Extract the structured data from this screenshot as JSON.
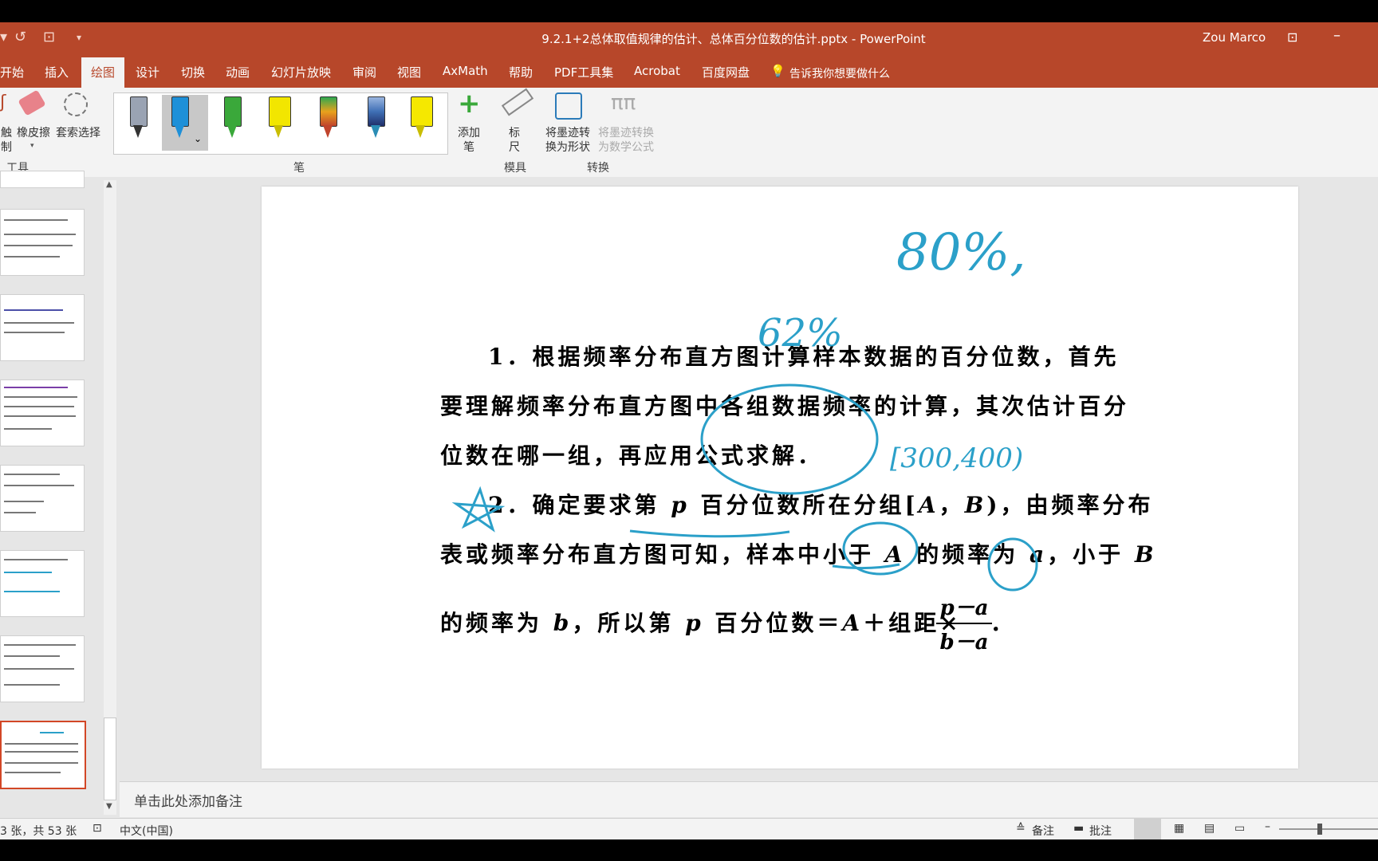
{
  "window": {
    "title": "9.2.1+2总体取值规律的估计、总体百分位数的估计.pptx  -  PowerPoint",
    "user": "Zou Marco"
  },
  "tabs": [
    "开始",
    "插入",
    "绘图",
    "设计",
    "切换",
    "动画",
    "幻灯片放映",
    "审阅",
    "视图",
    "AxMath",
    "帮助",
    "PDF工具集",
    "Acrobat",
    "百度网盘"
  ],
  "tell_me": "告诉我你想要做什么",
  "ribbon": {
    "draw_label": "触\n制",
    "eraser": "橡皮擦",
    "lasso": "套索选择",
    "tools_group": "工具",
    "pens_group": "笔",
    "add_pen": "添加\n笔",
    "ruler": "标\n尺",
    "stencils_group": "模具",
    "ink_to_shape": "将墨迹转\n换为形状",
    "ink_to_math": "将墨迹转换\n为数学公式",
    "convert_group": "转换",
    "pen_colors": [
      "#9aa3b3",
      "#1e90d8",
      "#3aa83a",
      "#f2e600",
      "#c0442c",
      "#3f6fb5",
      "#f5e800"
    ]
  },
  "slide": {
    "p1_line1": "1．根据频率分布直方图计算样本数据的百分位数，首先",
    "p1_line2": "要理解频率分布直方图中各组数据频率的计算，其次估计百分",
    "p1_line3": "位数在哪一组，再应用公式求解．",
    "p2_line1a": "2．确定要求第 ",
    "p2_line1_p": "p",
    "p2_line1b": " 百分位数所在分组[",
    "p2_line1_A": "A",
    "p2_line1_comma": "，",
    "p2_line1_B": "B",
    "p2_line1c": ")，由频率分布",
    "p2_line2a": "表或频率分布直方图可知，样本中小于 ",
    "p2_line2_A": "A",
    "p2_line2b": " 的频率为 ",
    "p2_line2_a": "a",
    "p2_line2c": "，小于 ",
    "p2_line2_B": "B",
    "p2_line3a": "的频率为 ",
    "p2_line3_b": "b",
    "p2_line3b": "，所以第 ",
    "p2_line3_p": "p",
    "p2_line3c": " 百分位数＝",
    "p2_line3_A": "A",
    "p2_line3d": "＋组距×",
    "frac_num": "p－a",
    "frac_den": "b－a",
    "frac_dot": "．",
    "ink_80": "80%,",
    "ink_62": "62%",
    "ink_interval": "[300,400)"
  },
  "notes_placeholder": "单击此处添加备注",
  "status": {
    "slide_count": "3 张，共 53 张",
    "language": "中文(中国)",
    "notes": "备注",
    "comments": "批注"
  }
}
